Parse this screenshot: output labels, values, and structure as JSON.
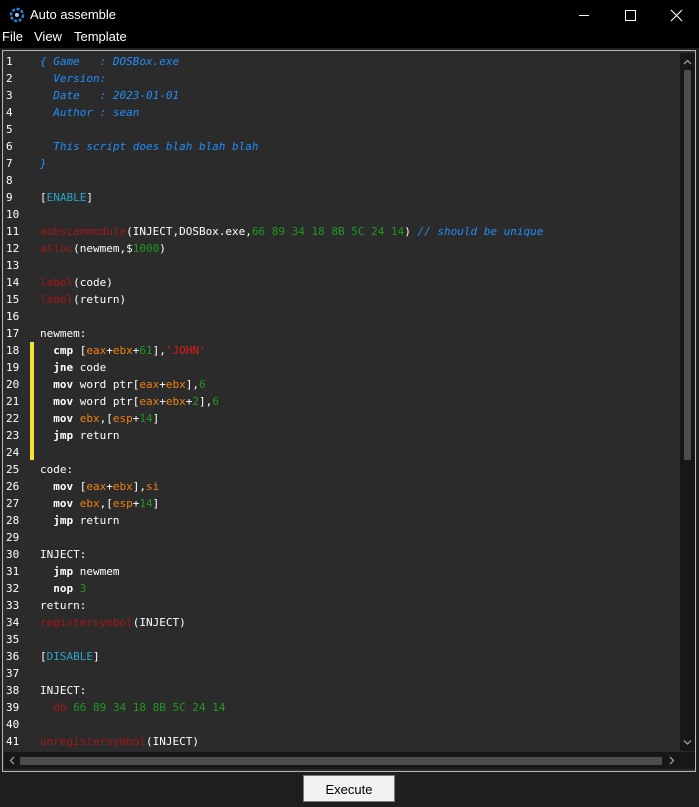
{
  "window": {
    "title": "Auto assemble",
    "icon": "cheat-engine-icon"
  },
  "menu": {
    "items": [
      "File",
      "View",
      "Template"
    ]
  },
  "editor": {
    "line_numbers": [
      "1",
      "2",
      "3",
      "4",
      "5",
      "6",
      "7",
      "8",
      "9",
      "10",
      "11",
      "12",
      "13",
      "14",
      "15",
      "16",
      "17",
      "18",
      "19",
      "20",
      "21",
      "22",
      "23",
      "24",
      "25",
      "26",
      "27",
      "28",
      "29",
      "30",
      "31",
      "32",
      "33",
      "34",
      "35",
      "36",
      "37",
      "38",
      "39",
      "40",
      "41"
    ],
    "lines": [
      [
        [
          "{ Game   : DOSBox.exe",
          "c"
        ]
      ],
      [
        [
          "  Version:",
          "c"
        ]
      ],
      [
        [
          "  Date   : 2023-01-01",
          "c"
        ]
      ],
      [
        [
          "  Author : sean",
          "c"
        ]
      ],
      [],
      [
        [
          "  This script does blah blah blah",
          "c"
        ]
      ],
      [
        [
          "}",
          "c"
        ]
      ],
      [],
      [
        [
          "[",
          "w"
        ],
        [
          "ENABLE",
          "s"
        ],
        [
          "]",
          "w"
        ]
      ],
      [],
      [
        [
          "aobscanmodule",
          "k"
        ],
        [
          "(INJECT,DOSBox.exe,",
          "w"
        ],
        [
          "66 89 34 18 8B 5C 24 14",
          "n"
        ],
        [
          ") ",
          "w"
        ],
        [
          "// should be unique",
          "c"
        ]
      ],
      [
        [
          "alloc",
          "k"
        ],
        [
          "(newmem,$",
          "w"
        ],
        [
          "1000",
          "n"
        ],
        [
          ")",
          "w"
        ]
      ],
      [],
      [
        [
          "label",
          "k"
        ],
        [
          "(code)",
          "w"
        ]
      ],
      [
        [
          "label",
          "k"
        ],
        [
          "(return)",
          "w"
        ]
      ],
      [],
      [
        [
          "newmem:",
          "w"
        ]
      ],
      [
        [
          "  ",
          "w"
        ],
        [
          "cmp",
          "b"
        ],
        [
          " [",
          "w"
        ],
        [
          "eax",
          "r"
        ],
        [
          "+",
          "w"
        ],
        [
          "ebx",
          "r"
        ],
        [
          "+",
          "w"
        ],
        [
          "61",
          "n"
        ],
        [
          "],",
          "w"
        ],
        [
          "'JOHN'",
          "q"
        ]
      ],
      [
        [
          "  ",
          "w"
        ],
        [
          "jne",
          "b"
        ],
        [
          " code",
          "w"
        ]
      ],
      [
        [
          "  ",
          "w"
        ],
        [
          "mov",
          "b"
        ],
        [
          " word ptr[",
          "w"
        ],
        [
          "eax",
          "r"
        ],
        [
          "+",
          "w"
        ],
        [
          "ebx",
          "r"
        ],
        [
          "],",
          "w"
        ],
        [
          "6",
          "n"
        ]
      ],
      [
        [
          "  ",
          "w"
        ],
        [
          "mov",
          "b"
        ],
        [
          " word ptr[",
          "w"
        ],
        [
          "eax",
          "r"
        ],
        [
          "+",
          "w"
        ],
        [
          "ebx",
          "r"
        ],
        [
          "+",
          "w"
        ],
        [
          "2",
          "n"
        ],
        [
          "],",
          "w"
        ],
        [
          "6",
          "n"
        ]
      ],
      [
        [
          "  ",
          "w"
        ],
        [
          "mov",
          "b"
        ],
        [
          " ",
          "w"
        ],
        [
          "ebx",
          "r"
        ],
        [
          ",[",
          "w"
        ],
        [
          "esp",
          "r"
        ],
        [
          "+",
          "w"
        ],
        [
          "14",
          "n"
        ],
        [
          "]",
          "w"
        ]
      ],
      [
        [
          "  ",
          "w"
        ],
        [
          "jmp",
          "b"
        ],
        [
          " return",
          "w"
        ]
      ],
      [],
      [
        [
          "code:",
          "w"
        ]
      ],
      [
        [
          "  ",
          "w"
        ],
        [
          "mov",
          "b"
        ],
        [
          " [",
          "w"
        ],
        [
          "eax",
          "r"
        ],
        [
          "+",
          "w"
        ],
        [
          "ebx",
          "r"
        ],
        [
          "],",
          "w"
        ],
        [
          "si",
          "r"
        ]
      ],
      [
        [
          "  ",
          "w"
        ],
        [
          "mov",
          "b"
        ],
        [
          " ",
          "w"
        ],
        [
          "ebx",
          "r"
        ],
        [
          ",[",
          "w"
        ],
        [
          "esp",
          "r"
        ],
        [
          "+",
          "w"
        ],
        [
          "14",
          "n"
        ],
        [
          "]",
          "w"
        ]
      ],
      [
        [
          "  ",
          "w"
        ],
        [
          "jmp",
          "b"
        ],
        [
          " return",
          "w"
        ]
      ],
      [],
      [
        [
          "INJECT:",
          "w"
        ]
      ],
      [
        [
          "  ",
          "w"
        ],
        [
          "jmp",
          "b"
        ],
        [
          " newmem",
          "w"
        ]
      ],
      [
        [
          "  ",
          "w"
        ],
        [
          "nop",
          "b"
        ],
        [
          " ",
          "w"
        ],
        [
          "3",
          "n"
        ]
      ],
      [
        [
          "return:",
          "w"
        ]
      ],
      [
        [
          "registersymbol",
          "k"
        ],
        [
          "(INJECT)",
          "w"
        ]
      ],
      [],
      [
        [
          "[",
          "w"
        ],
        [
          "DISABLE",
          "s"
        ],
        [
          "]",
          "w"
        ]
      ],
      [],
      [
        [
          "INJECT:",
          "w"
        ]
      ],
      [
        [
          "  ",
          "w"
        ],
        [
          "db",
          "k"
        ],
        [
          " ",
          "w"
        ],
        [
          "66 89 34 18 8B 5C 24 14",
          "n"
        ]
      ],
      [],
      [
        [
          "unregistersymbol",
          "k"
        ],
        [
          "(INJECT)",
          "w"
        ]
      ]
    ]
  },
  "colors": {
    "c": "#1f8fff",
    "w": "#ffffff",
    "k": "#a5161a",
    "n": "#1f9a1f",
    "s": "#2aa4cc",
    "r": "#f0820f",
    "q": "#e01818",
    "b": "#ffffff"
  },
  "footer": {
    "execute_label": "Execute"
  }
}
